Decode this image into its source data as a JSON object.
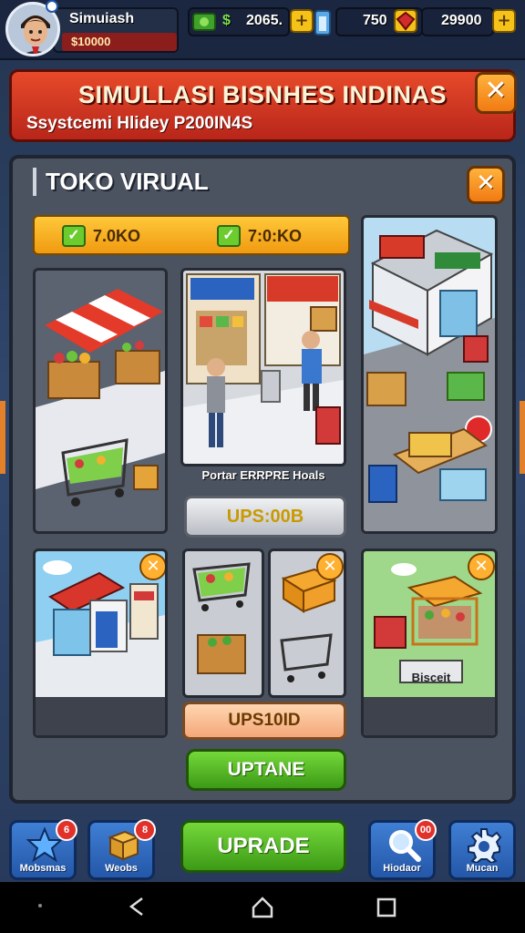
{
  "player": {
    "name": "Simuiash",
    "money": "$10000"
  },
  "resources": [
    {
      "icon": "cash-icon",
      "value": "2065."
    },
    {
      "icon": "energy-icon",
      "value": "750"
    },
    {
      "icon": "gem-icon",
      "value": "29900"
    }
  ],
  "banner": {
    "title": "SIMULLASI BISNHES INDINAS",
    "subtitle": "Ssystcemi Hlidey P200IN4S"
  },
  "panel": {
    "title": "TOKO VIRUAL",
    "tabs": [
      {
        "label": "7.0KO"
      },
      {
        "label": "7:0:KO"
      }
    ],
    "center_card": {
      "caption": "Portar ERRPRE Hoals",
      "price_button": "UPS:00B"
    },
    "bottom_card": {
      "price_button": "UPS10ID",
      "upgrade_button": "UPTANE"
    },
    "right_bottom_card": {
      "label": "Bisceit"
    }
  },
  "bottom_nav": {
    "items": [
      {
        "label": "Mobsmas",
        "badge": "6"
      },
      {
        "label": "Weobs",
        "badge": "8"
      },
      {
        "label": "Hiodaor",
        "badge": "00"
      },
      {
        "label": "Mucan",
        "badge": ""
      }
    ],
    "upgrade_label": "UPRADE"
  },
  "colors": {
    "accent": "#f5c21a",
    "banner": "#d63a22",
    "green": "#4caf1f"
  }
}
